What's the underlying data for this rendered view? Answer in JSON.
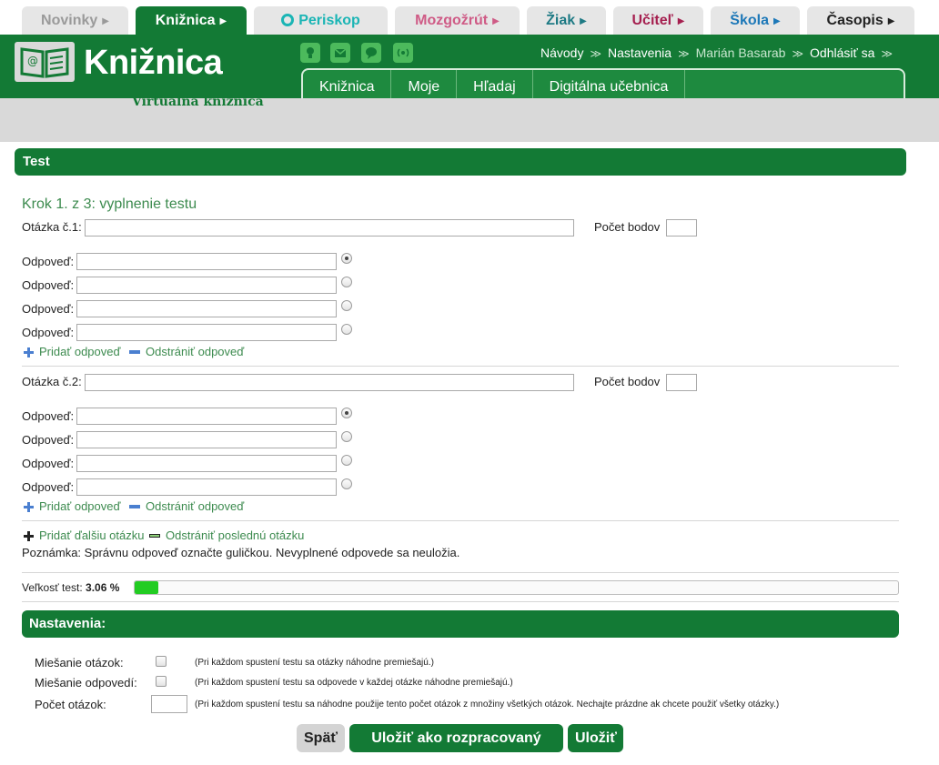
{
  "portal_tabs": [
    {
      "label": "Novinky",
      "color": "#9a9a9a",
      "arrow_color": "#9a9a9a"
    },
    {
      "label": "Knižnica",
      "color": "#ffffff",
      "arrow_color": "#ffffff"
    },
    {
      "label": "Periskop",
      "color": "#1bb5b5",
      "arrow_color": "#1bb5b5"
    },
    {
      "label": "Mozgožrút",
      "color": "#cf5b86",
      "arrow_color": "#cf5b86"
    },
    {
      "label": "Žiak",
      "color": "#1e7a84",
      "arrow_color": "#1e7a84"
    },
    {
      "label": "Učiteľ",
      "color": "#a51f4f",
      "arrow_color": "#a51f4f"
    },
    {
      "label": "Škola",
      "color": "#1d78b8",
      "arrow_color": "#1d78b8"
    },
    {
      "label": "Časopis",
      "color": "#222222",
      "arrow_color": "#222222"
    }
  ],
  "header": {
    "logo_text": "Knižnica",
    "subtitle": "Virtuálna knižnica",
    "user_links": [
      "Návody",
      "Nastavenia",
      "Marián Basarab",
      "Odhlásiť sa"
    ],
    "main_nav": [
      "Knižnica",
      "Moje",
      "Hľadaj",
      "Digitálna učebnica"
    ]
  },
  "test_section": {
    "title": "Test",
    "step_title": "Krok 1. z 3: vyplnenie testu",
    "questions": [
      {
        "label": "Otázka č.1:",
        "points_label": "Počet bodov",
        "answer_label": "Odpoveď:",
        "answer_count": 4,
        "selected_answer": 0
      },
      {
        "label": "Otázka č.2:",
        "points_label": "Počet bodov",
        "answer_label": "Odpoveď:",
        "answer_count": 4,
        "selected_answer": 0
      }
    ],
    "add_answer": "Pridať odpoveď",
    "remove_answer": "Odstrániť odpoveď",
    "add_question": "Pridať ďalšiu otázku",
    "remove_question": "Odstrániť poslednú otázku",
    "note": "Poznámka: Správnu odpoveď označte guličkou. Nevyplnené odpovede sa neuložia.",
    "size_label": "Veľkosť test:",
    "size_value": "3.06 %",
    "size_fraction": 0.0306
  },
  "settings": {
    "title": "Nastavenia:",
    "shuffle_questions_label": "Miešanie otázok:",
    "shuffle_questions_hint": "(Pri každom spustení testu sa otázky náhodne premiešajú.)",
    "shuffle_answers_label": "Miešanie odpovedí:",
    "shuffle_answers_hint": "(Pri každom spustení testu sa odpovede v každej otázke náhodne premiešajú.)",
    "question_count_label": "Počet otázok:",
    "question_count_hint": "(Pri každom spustení testu sa náhodne použije tento počet otázok z množiny všetkých otázok. Nechajte prázdne ak chcete použiť všetky otázky.)"
  },
  "buttons": {
    "back": "Späť",
    "save_draft": "Uložiť ako rozpracovaný test",
    "save": "Uložiť"
  },
  "colors": {
    "brand_green": "#137a35",
    "link_green": "#3d8b4f",
    "progress_fill": "#22cc22"
  }
}
